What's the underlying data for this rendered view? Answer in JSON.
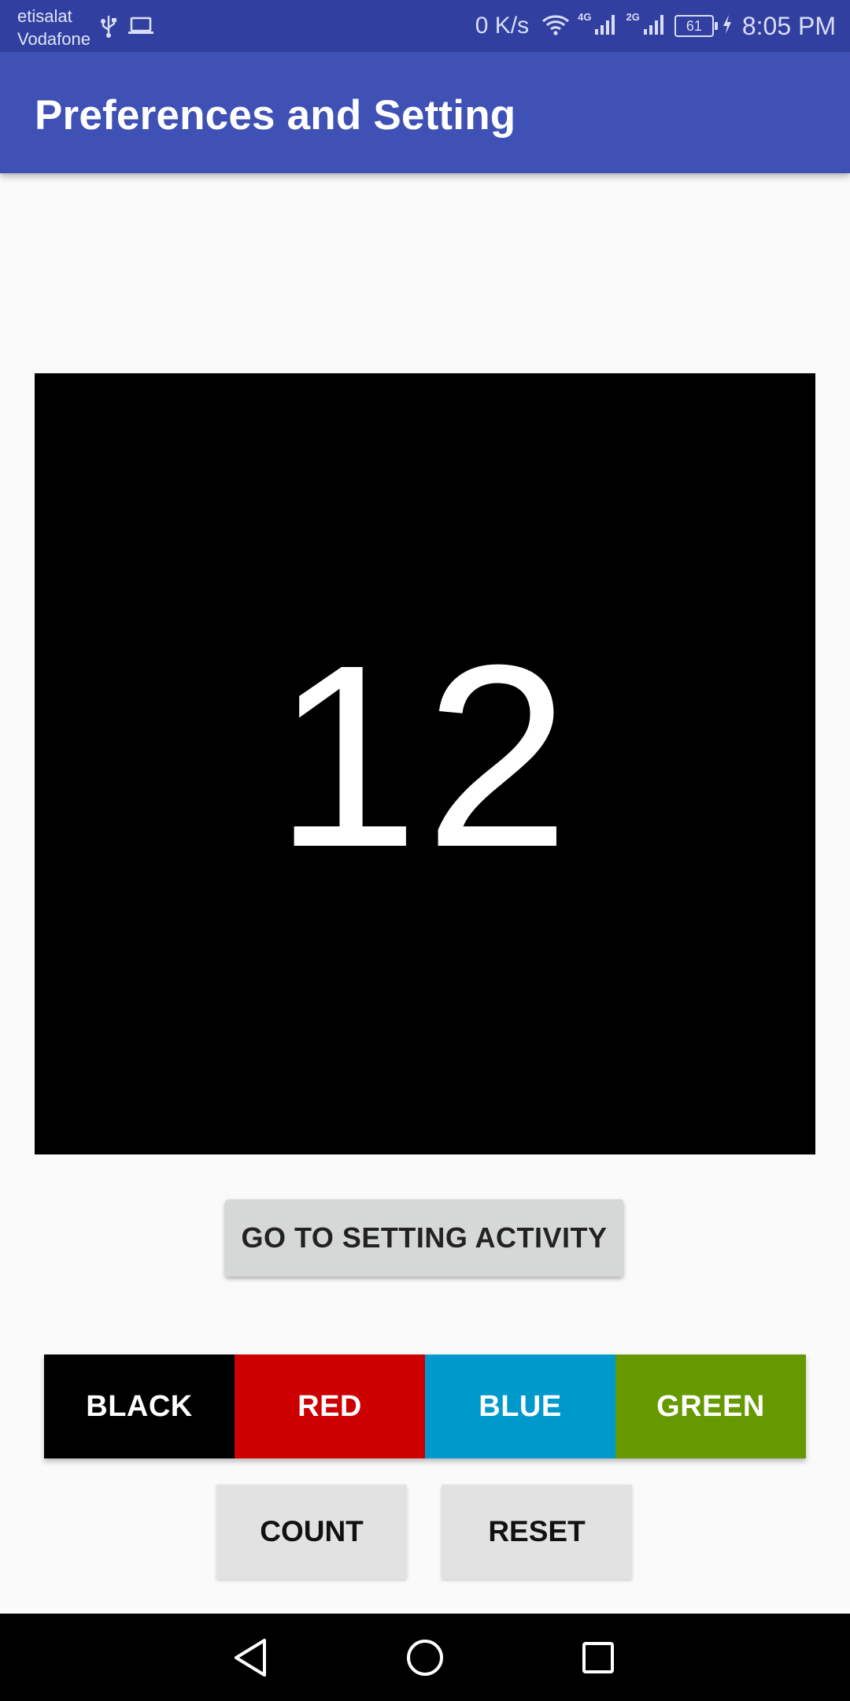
{
  "status_bar": {
    "carrier_line1": "etisalat",
    "carrier_line2": "Vodafone",
    "usb_icon": "usb-icon",
    "laptop_icon": "laptop-icon",
    "net_speed": "0 K/s",
    "network_4g": "4G",
    "network_2g": "2G",
    "battery": "61",
    "time": "8:05 PM"
  },
  "app_bar": {
    "title": "Preferences and Setting",
    "color": "#3f51b5"
  },
  "counter": {
    "value": "12",
    "background": "#000000",
    "text_color": "#ffffff"
  },
  "settings_button": {
    "label": "GO TO SETTING ACTIVITY"
  },
  "color_buttons": [
    {
      "label": "BLACK",
      "color": "#000000"
    },
    {
      "label": "RED",
      "color": "#cc0000"
    },
    {
      "label": "BLUE",
      "color": "#0099cc"
    },
    {
      "label": "GREEN",
      "color": "#669900"
    }
  ],
  "actions": {
    "count_label": "COUNT",
    "reset_label": "RESET"
  },
  "nav_bar": {
    "back_icon": "back-icon",
    "home_icon": "home-icon",
    "recent_icon": "recent-apps-icon"
  }
}
